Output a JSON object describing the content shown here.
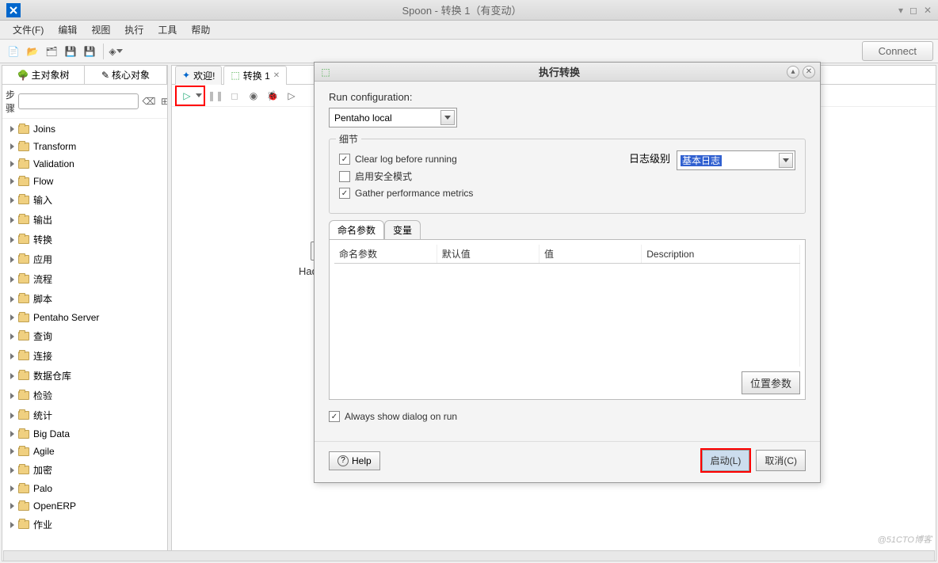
{
  "window": {
    "title": "Spoon - 转换 1（有变动）"
  },
  "menu": [
    "文件(F)",
    "编辑",
    "视图",
    "执行",
    "工具",
    "帮助"
  ],
  "toolbar": {
    "connect": "Connect"
  },
  "left": {
    "tab1": "主对象树",
    "tab2": "核心对象",
    "stepsLabel": "步骤",
    "items": [
      "Joins",
      "Transform",
      "Validation",
      "Flow",
      "输入",
      "输出",
      "转换",
      "应用",
      "流程",
      "脚本",
      "Pentaho Server",
      "查询",
      "连接",
      "数据仓库",
      "检验",
      "统计",
      "Big Data",
      "Agile",
      "加密",
      "Palo",
      "OpenERP",
      "作业"
    ]
  },
  "tabs": {
    "welcome": "欢迎!",
    "trans": "转换 1"
  },
  "canvas": {
    "node": "Hadoop"
  },
  "dialog": {
    "title": "执行转换",
    "runConfigLabel": "Run configuration:",
    "runConfigValue": "Pentaho local",
    "detailsLegend": "细节",
    "clearLog": "Clear log before running",
    "safeMode": "启用安全模式",
    "gatherMetrics": "Gather performance metrics",
    "logLevelLabel": "日志级别",
    "logLevelValue": "基本日志",
    "tabParams": "命名参数",
    "tabVars": "变量",
    "cols": {
      "name": "命名参数",
      "default": "默认值",
      "value": "值",
      "desc": "Description"
    },
    "posParams": "位置参数",
    "alwaysShow": "Always show dialog on run",
    "help": "Help",
    "start": "启动(L)",
    "cancel": "取消(C)"
  },
  "watermark": "@51CTO博客"
}
